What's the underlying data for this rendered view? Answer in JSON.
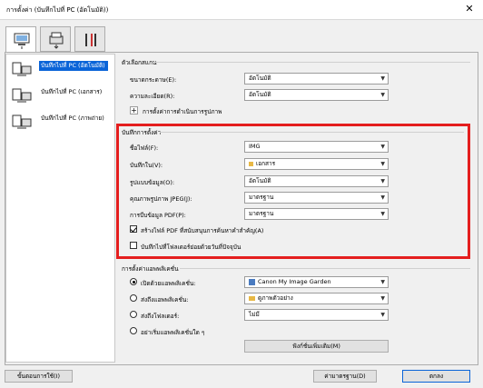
{
  "window": {
    "title": "การตั้งค่า (บันทึกไปที่ PC (อัตโนมัติ))",
    "close_glyph": "✕"
  },
  "left_list": [
    {
      "label": "บันทึกไปที่ PC (อัตโนมัติ)",
      "selected": true
    },
    {
      "label": "บันทึกไปที่ PC (เอกสาร)",
      "selected": false
    },
    {
      "label": "บันทึกไปที่ PC (ภาพถ่าย)",
      "selected": false
    }
  ],
  "scan_options": {
    "title": "ตัวเลือกสแกน",
    "paper_size_label": "ขนาดกระดาษ(E):",
    "paper_size_value": "อัตโนมัติ",
    "resolution_label": "ความละเอียด(R):",
    "resolution_value": "อัตโนมัติ",
    "image_processing_label": "การตั้งค่าการดำเนินการรูปภาพ"
  },
  "save_settings": {
    "title": "บันทึกการตั้งค่า",
    "file_name_label": "ชื่อไฟล์(F):",
    "file_name_value": "IMG",
    "save_in_label": "บันทึกใน(V):",
    "save_in_value": "เอกสาร",
    "data_format_label": "รูปแบบข้อมูล(O):",
    "data_format_value": "อัตโนมัติ",
    "jpeg_quality_label": "คุณภาพรูปภาพ JPEG(J):",
    "jpeg_quality_value": "มาตรฐาน",
    "pdf_compression_label": "การบีบข้อมูล PDF(P):",
    "pdf_compression_value": "มาตรฐาน",
    "keyword_pdf_label": "สร้างไฟล์ PDF ที่สนับสนุนการค้นหาคำสำคัญ(A)",
    "keyword_pdf_checked": true,
    "subfolder_label": "บันทึกไปที่โฟลเดอร์ย่อยด้วยวันที่ปัจจุบัน",
    "subfolder_checked": false
  },
  "app_settings": {
    "title": "การตั้งค่าแอพพลิเคชั่น",
    "open_app_label": "เปิดด้วยแอพพลิเคชั่น:",
    "open_app_value": "Canon My Image Garden",
    "send_app_label": "ส่งถึงแอพพลิเคชั่น:",
    "send_app_value": "ดูภาพตัวอย่าง",
    "send_folder_label": "ส่งถึงโฟลเดอร์:",
    "send_folder_value": "ไม่มี",
    "no_app_label": "อย่าเริ่มแอพพลิเคชั่นใด ๆ",
    "selected_option": "open_app",
    "more_functions_button": "ฟังก์ชั่นเพิ่มเติม(M)"
  },
  "footer": {
    "instructions_button": "ขั้นตอนการใช้(I)",
    "defaults_button": "ค่ามาตรฐาน(D)",
    "ok_button": "ตกลง"
  },
  "colors": {
    "selection": "#0a64d8",
    "highlight_box": "#e41e1e"
  }
}
